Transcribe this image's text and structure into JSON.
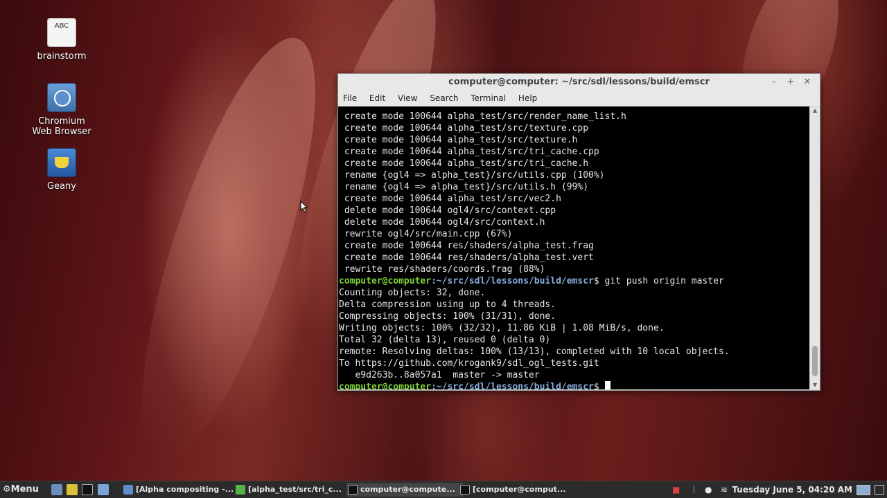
{
  "desktop": {
    "icons": [
      {
        "label": "brainstorm",
        "glyph": "ABC"
      },
      {
        "label": "Chromium Web Browser"
      },
      {
        "label": "Geany"
      }
    ]
  },
  "terminal": {
    "title": "computer@computer: ~/src/sdl/lessons/build/emscr",
    "menu": [
      "File",
      "Edit",
      "View",
      "Search",
      "Terminal",
      "Help"
    ],
    "output_lines": [
      " create mode 100644 alpha_test/src/render_name_list.h",
      " create mode 100644 alpha_test/src/texture.cpp",
      " create mode 100644 alpha_test/src/texture.h",
      " create mode 100644 alpha_test/src/tri_cache.cpp",
      " create mode 100644 alpha_test/src/tri_cache.h",
      " rename {ogl4 => alpha_test}/src/utils.cpp (100%)",
      " rename {ogl4 => alpha_test}/src/utils.h (99%)",
      " create mode 100644 alpha_test/src/vec2.h",
      " delete mode 100644 ogl4/src/context.cpp",
      " delete mode 100644 ogl4/src/context.h",
      " rewrite ogl4/src/main.cpp (67%)",
      " create mode 100644 res/shaders/alpha_test.frag",
      " create mode 100644 res/shaders/alpha_test.vert",
      " rewrite res/shaders/coords.frag (88%)"
    ],
    "prompt_user": "computer@computer",
    "prompt_path": ":~/src/sdl/lessons/build/emscr",
    "prompt_symbol": "$ ",
    "command": "git push origin master",
    "push_output": [
      "Counting objects: 32, done.",
      "Delta compression using up to 4 threads.",
      "Compressing objects: 100% (31/31), done.",
      "Writing objects: 100% (32/32), 11.86 KiB | 1.08 MiB/s, done.",
      "Total 32 (delta 13), reused 0 (delta 0)",
      "remote: Resolving deltas: 100% (13/13), completed with 10 local objects.",
      "To https://github.com/krogank9/sdl_ogl_tests.git",
      "   e9d263b..8a057a1  master -> master"
    ]
  },
  "taskbar": {
    "menu_label": "Menu",
    "tasks": [
      {
        "label": "[Alpha compositing -...",
        "active": false
      },
      {
        "label": "[alpha_test/src/tri_c...",
        "active": false
      },
      {
        "label": "computer@compute...",
        "active": true
      },
      {
        "label": "[computer@comput...",
        "active": false
      }
    ],
    "clock": "Tuesday June  5, 04:20 AM"
  },
  "colors": {
    "prompt_user": "#7fd23a",
    "prompt_path": "#88aee0",
    "terminal_bg": "#000000"
  }
}
